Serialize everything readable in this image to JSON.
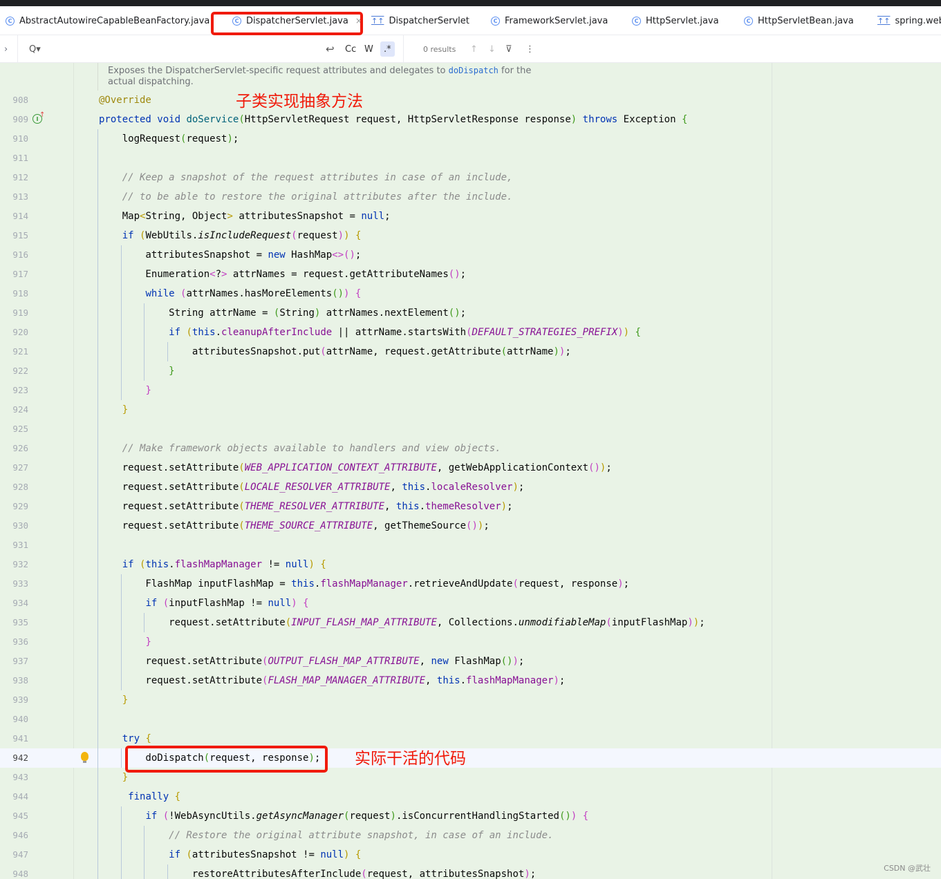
{
  "tabs": [
    {
      "label": "AbstractAutowireCapableBeanFactory.java",
      "icon": "class-icon"
    },
    {
      "label": "DispatcherServlet.java",
      "icon": "class-icon",
      "active": true,
      "close": "×"
    },
    {
      "label": "DispatcherServlet",
      "icon": "structure-icon"
    },
    {
      "label": "FrameworkServlet.java",
      "icon": "class-icon"
    },
    {
      "label": "HttpServlet.java",
      "icon": "class-icon"
    },
    {
      "label": "HttpServletBean.java",
      "icon": "class-icon"
    },
    {
      "label": "spring.webr",
      "icon": "structure-icon"
    }
  ],
  "search": {
    "value": "",
    "results": "0 results",
    "match_case": "Cc",
    "words": "W",
    "regex": ".*",
    "regex_active": true
  },
  "doc": {
    "line1_pre": "Exposes the DispatcherServlet-specific request attributes and delegates to ",
    "link": "doDispatch",
    "line1_post": " for the",
    "line2": "actual dispatching."
  },
  "annotations": {
    "top": "子类实现抽象方法",
    "bottom": "实际干活的代码",
    "highlight_color": "#f01a0a"
  },
  "watermark": "CSDN @武壮",
  "current_line": 942,
  "lines": [
    {
      "n": 908,
      "t": [
        [
          "a",
          "@Override"
        ]
      ]
    },
    {
      "n": 909,
      "t": [
        [
          "k",
          "protected"
        ],
        [
          "",
          " "
        ],
        [
          "k",
          "void"
        ],
        [
          "",
          " "
        ],
        [
          "m",
          "doService"
        ],
        [
          "g",
          "("
        ],
        [
          "",
          "HttpServletRequest request, HttpServletResponse response"
        ],
        [
          "g",
          ")"
        ],
        [
          "",
          " "
        ],
        [
          "k",
          "throws"
        ],
        [
          "",
          " Exception "
        ],
        [
          "g",
          "{"
        ]
      ],
      "icon": "implements-icon"
    },
    {
      "n": 910,
      "t": [
        [
          "",
          "    logRequest"
        ],
        [
          "g",
          "("
        ],
        [
          "",
          "request"
        ],
        [
          "g",
          ")"
        ],
        [
          "",
          ";"
        ]
      ]
    },
    {
      "n": 911,
      "t": []
    },
    {
      "n": 912,
      "t": [
        [
          "c",
          "    // Keep a snapshot of the request attributes in case of an include,"
        ]
      ]
    },
    {
      "n": 913,
      "t": [
        [
          "c",
          "    // to be able to restore the original attributes after the include."
        ]
      ]
    },
    {
      "n": 914,
      "t": [
        [
          "",
          "    Map"
        ],
        [
          "y",
          "<"
        ],
        [
          "",
          "String, Object"
        ],
        [
          "y",
          ">"
        ],
        [
          "",
          " attributesSnapshot = "
        ],
        [
          "k",
          "null"
        ],
        [
          "",
          ";"
        ]
      ]
    },
    {
      "n": 915,
      "t": [
        [
          "",
          "    "
        ],
        [
          "k",
          "if"
        ],
        [
          "",
          " "
        ],
        [
          "y",
          "("
        ],
        [
          "",
          "WebUtils."
        ],
        [
          "s",
          "isIncludeRequest"
        ],
        [
          "p",
          "("
        ],
        [
          "",
          "request"
        ],
        [
          "p",
          ")"
        ],
        [
          "y",
          ")"
        ],
        [
          "",
          " "
        ],
        [
          "y",
          "{"
        ]
      ]
    },
    {
      "n": 916,
      "t": [
        [
          "",
          "        attributesSnapshot = "
        ],
        [
          "k",
          "new"
        ],
        [
          "",
          " HashMap"
        ],
        [
          "p",
          "<>()"
        ],
        [
          "",
          ";"
        ]
      ]
    },
    {
      "n": 917,
      "t": [
        [
          "",
          "        Enumeration"
        ],
        [
          "p",
          "<"
        ],
        [
          "",
          "?"
        ],
        [
          "p",
          ">"
        ],
        [
          "",
          " attrNames = request.getAttributeNames"
        ],
        [
          "p",
          "()"
        ],
        [
          "",
          ";"
        ]
      ]
    },
    {
      "n": 918,
      "t": [
        [
          "",
          "        "
        ],
        [
          "k",
          "while"
        ],
        [
          "",
          " "
        ],
        [
          "p",
          "("
        ],
        [
          "",
          "attrNames.hasMoreElements"
        ],
        [
          "g",
          "()"
        ],
        [
          "p",
          ")"
        ],
        [
          "",
          " "
        ],
        [
          "p",
          "{"
        ]
      ]
    },
    {
      "n": 919,
      "t": [
        [
          "",
          "            String attrName = "
        ],
        [
          "g",
          "("
        ],
        [
          "",
          "String"
        ],
        [
          "g",
          ")"
        ],
        [
          "",
          " attrNames.nextElement"
        ],
        [
          "g",
          "()"
        ],
        [
          "",
          ";"
        ]
      ]
    },
    {
      "n": 920,
      "t": [
        [
          "",
          "            "
        ],
        [
          "k",
          "if"
        ],
        [
          "",
          " "
        ],
        [
          "y",
          "("
        ],
        [
          "k",
          "this"
        ],
        [
          "",
          "."
        ],
        [
          "f",
          "cleanupAfterInclude"
        ],
        [
          "",
          " || attrName.startsWith"
        ],
        [
          "p",
          "("
        ],
        [
          "C",
          "DEFAULT_STRATEGIES_PREFIX"
        ],
        [
          "p",
          ")"
        ],
        [
          "y",
          ")"
        ],
        [
          "",
          " "
        ],
        [
          "g",
          "{"
        ]
      ]
    },
    {
      "n": 921,
      "t": [
        [
          "",
          "                attributesSnapshot.put"
        ],
        [
          "p",
          "("
        ],
        [
          "",
          "attrName, request.getAttribute"
        ],
        [
          "g",
          "("
        ],
        [
          "",
          "attrName"
        ],
        [
          "g",
          ")"
        ],
        [
          "p",
          ")"
        ],
        [
          "",
          ";"
        ]
      ]
    },
    {
      "n": 922,
      "t": [
        [
          "",
          "            "
        ],
        [
          "g",
          "}"
        ]
      ]
    },
    {
      "n": 923,
      "t": [
        [
          "",
          "        "
        ],
        [
          "p",
          "}"
        ]
      ]
    },
    {
      "n": 924,
      "t": [
        [
          "",
          "    "
        ],
        [
          "y",
          "}"
        ]
      ]
    },
    {
      "n": 925,
      "t": []
    },
    {
      "n": 926,
      "t": [
        [
          "c",
          "    // Make framework objects available to handlers and view objects."
        ]
      ]
    },
    {
      "n": 927,
      "t": [
        [
          "",
          "    request.setAttribute"
        ],
        [
          "y",
          "("
        ],
        [
          "C",
          "WEB_APPLICATION_CONTEXT_ATTRIBUTE"
        ],
        [
          "",
          ", getWebApplicationContext"
        ],
        [
          "p",
          "()"
        ],
        [
          "y",
          ")"
        ],
        [
          "",
          ";"
        ]
      ]
    },
    {
      "n": 928,
      "t": [
        [
          "",
          "    request.setAttribute"
        ],
        [
          "y",
          "("
        ],
        [
          "C",
          "LOCALE_RESOLVER_ATTRIBUTE"
        ],
        [
          "",
          ", "
        ],
        [
          "k",
          "this"
        ],
        [
          "",
          "."
        ],
        [
          "f",
          "localeResolver"
        ],
        [
          "y",
          ")"
        ],
        [
          "",
          ";"
        ]
      ]
    },
    {
      "n": 929,
      "t": [
        [
          "",
          "    request.setAttribute"
        ],
        [
          "y",
          "("
        ],
        [
          "C",
          "THEME_RESOLVER_ATTRIBUTE"
        ],
        [
          "",
          ", "
        ],
        [
          "k",
          "this"
        ],
        [
          "",
          "."
        ],
        [
          "f",
          "themeResolver"
        ],
        [
          "y",
          ")"
        ],
        [
          "",
          ";"
        ]
      ]
    },
    {
      "n": 930,
      "t": [
        [
          "",
          "    request.setAttribute"
        ],
        [
          "y",
          "("
        ],
        [
          "C",
          "THEME_SOURCE_ATTRIBUTE"
        ],
        [
          "",
          ", getThemeSource"
        ],
        [
          "p",
          "()"
        ],
        [
          "y",
          ")"
        ],
        [
          "",
          ";"
        ]
      ]
    },
    {
      "n": 931,
      "t": []
    },
    {
      "n": 932,
      "t": [
        [
          "",
          "    "
        ],
        [
          "k",
          "if"
        ],
        [
          "",
          " "
        ],
        [
          "y",
          "("
        ],
        [
          "k",
          "this"
        ],
        [
          "",
          "."
        ],
        [
          "f",
          "flashMapManager"
        ],
        [
          "",
          " != "
        ],
        [
          "k",
          "null"
        ],
        [
          "y",
          ")"
        ],
        [
          "",
          " "
        ],
        [
          "y",
          "{"
        ]
      ]
    },
    {
      "n": 933,
      "t": [
        [
          "",
          "        FlashMap inputFlashMap = "
        ],
        [
          "k",
          "this"
        ],
        [
          "",
          "."
        ],
        [
          "f",
          "flashMapManager"
        ],
        [
          "",
          ".retrieveAndUpdate"
        ],
        [
          "p",
          "("
        ],
        [
          "",
          "request, response"
        ],
        [
          "p",
          ")"
        ],
        [
          "",
          ";"
        ]
      ]
    },
    {
      "n": 934,
      "t": [
        [
          "",
          "        "
        ],
        [
          "k",
          "if"
        ],
        [
          "",
          " "
        ],
        [
          "p",
          "("
        ],
        [
          "",
          "inputFlashMap != "
        ],
        [
          "k",
          "null"
        ],
        [
          "p",
          ")"
        ],
        [
          "",
          " "
        ],
        [
          "p",
          "{"
        ]
      ]
    },
    {
      "n": 935,
      "t": [
        [
          "",
          "            request.setAttribute"
        ],
        [
          "y",
          "("
        ],
        [
          "C",
          "INPUT_FLASH_MAP_ATTRIBUTE"
        ],
        [
          "",
          ", Collections."
        ],
        [
          "s",
          "unmodifiableMap"
        ],
        [
          "p",
          "("
        ],
        [
          "",
          "inputFlashMap"
        ],
        [
          "p",
          ")"
        ],
        [
          "y",
          ")"
        ],
        [
          "",
          ";"
        ]
      ]
    },
    {
      "n": 936,
      "t": [
        [
          "",
          "        "
        ],
        [
          "p",
          "}"
        ]
      ]
    },
    {
      "n": 937,
      "t": [
        [
          "",
          "        request.setAttribute"
        ],
        [
          "p",
          "("
        ],
        [
          "C",
          "OUTPUT_FLASH_MAP_ATTRIBUTE"
        ],
        [
          "",
          ", "
        ],
        [
          "k",
          "new"
        ],
        [
          "",
          " FlashMap"
        ],
        [
          "g",
          "()"
        ],
        [
          "p",
          ")"
        ],
        [
          "",
          ";"
        ]
      ]
    },
    {
      "n": 938,
      "t": [
        [
          "",
          "        request.setAttribute"
        ],
        [
          "p",
          "("
        ],
        [
          "C",
          "FLASH_MAP_MANAGER_ATTRIBUTE"
        ],
        [
          "",
          ", "
        ],
        [
          "k",
          "this"
        ],
        [
          "",
          "."
        ],
        [
          "f",
          "flashMapManager"
        ],
        [
          "p",
          ")"
        ],
        [
          "",
          ";"
        ]
      ]
    },
    {
      "n": 939,
      "t": [
        [
          "",
          "    "
        ],
        [
          "y",
          "}"
        ]
      ]
    },
    {
      "n": 940,
      "t": []
    },
    {
      "n": 941,
      "t": [
        [
          "",
          "    "
        ],
        [
          "k",
          "try"
        ],
        [
          "",
          " "
        ],
        [
          "y",
          "{"
        ]
      ]
    },
    {
      "n": 942,
      "t": [
        [
          "",
          "        doDispatch"
        ],
        [
          "g",
          "("
        ],
        [
          "",
          "request, response"
        ],
        [
          "g",
          ")"
        ],
        [
          "",
          ";"
        ]
      ],
      "icon": "lightbulb-icon"
    },
    {
      "n": 943,
      "t": [
        [
          "",
          "    "
        ],
        [
          "y",
          "}"
        ]
      ]
    },
    {
      "n": 944,
      "t": [
        [
          "",
          "     "
        ],
        [
          "k",
          "finally"
        ],
        [
          "",
          " "
        ],
        [
          "y",
          "{"
        ]
      ]
    },
    {
      "n": 945,
      "t": [
        [
          "",
          "        "
        ],
        [
          "k",
          "if"
        ],
        [
          "",
          " "
        ],
        [
          "p",
          "("
        ],
        [
          "",
          "!WebAsyncUtils."
        ],
        [
          "s",
          "getAsyncManager"
        ],
        [
          "g",
          "("
        ],
        [
          "",
          "request"
        ],
        [
          "g",
          ")"
        ],
        [
          "",
          ".isConcurrentHandlingStarted"
        ],
        [
          "g",
          "()"
        ],
        [
          "p",
          ")"
        ],
        [
          "",
          " "
        ],
        [
          "p",
          "{"
        ]
      ]
    },
    {
      "n": 946,
      "t": [
        [
          "c",
          "            // Restore the original attribute snapshot, in case of an include."
        ]
      ]
    },
    {
      "n": 947,
      "t": [
        [
          "",
          "            "
        ],
        [
          "k",
          "if"
        ],
        [
          "",
          " "
        ],
        [
          "y",
          "("
        ],
        [
          "",
          "attributesSnapshot != "
        ],
        [
          "k",
          "null"
        ],
        [
          "y",
          ")"
        ],
        [
          "",
          " "
        ],
        [
          "y",
          "{"
        ]
      ]
    },
    {
      "n": 948,
      "t": [
        [
          "",
          "                restoreAttributesAfterInclude"
        ],
        [
          "p",
          "("
        ],
        [
          "",
          "request, attributesSnapshot"
        ],
        [
          "p",
          ")"
        ],
        [
          "",
          ";"
        ]
      ]
    }
  ]
}
